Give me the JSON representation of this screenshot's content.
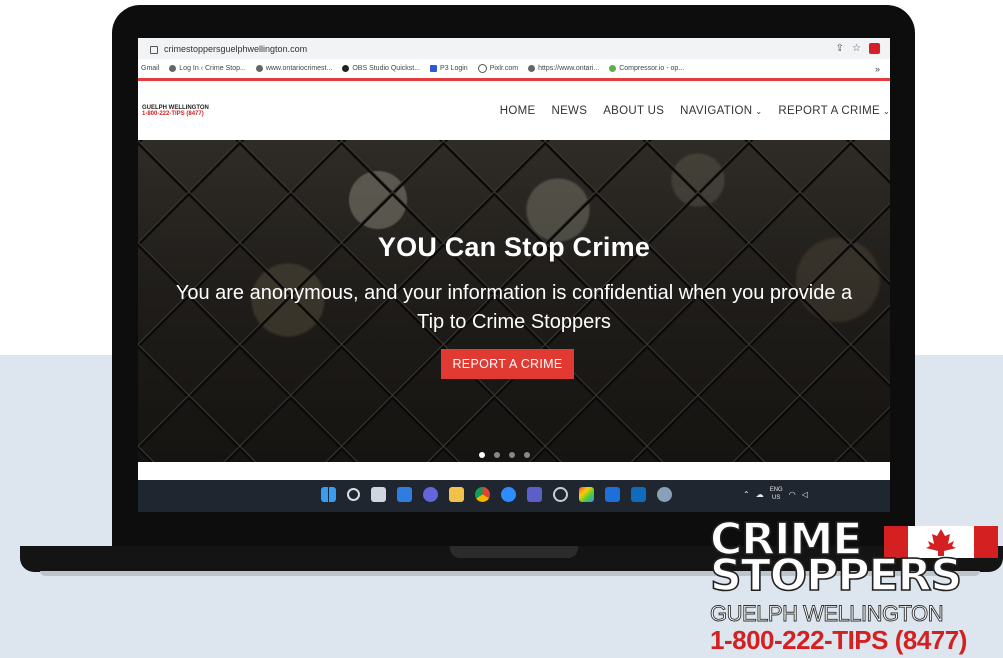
{
  "browser": {
    "url": "crimestoppersguelphwellington.com",
    "bookmarks": [
      "Gmail",
      "Log In ‹ Crime Stop...",
      "www.ontariocrimest...",
      "OBS Studio Quickst...",
      "P3 Login",
      "Pixlr.com",
      "https://www.ontari...",
      "Compressor.io - op..."
    ],
    "more": "»"
  },
  "site": {
    "logo_line1": "GUELPH WELLINGTON",
    "logo_line2": "1-800-222-TIPS (8477)",
    "nav": {
      "home": "HOME",
      "news": "NEWS",
      "about": "ABOUT US",
      "navigation": "NAVIGATION",
      "report": "REPORT A CRIME"
    }
  },
  "hero": {
    "title": "YOU Can Stop Crime",
    "subtitle": "You are anonymous, and your information is confidential when you provide a Tip to Crime Stoppers",
    "button": "REPORT A CRIME",
    "slides": 4,
    "active_slide": 1
  },
  "taskbar": {
    "lang1": "ENG",
    "lang2": "US"
  },
  "brand": {
    "line1": "CRIME",
    "line2": "STOPPERS",
    "line3": "GUELPH WELLINGTON",
    "line4": "1-800-222-TIPS (8477)"
  },
  "colors": {
    "accent_red": "#e03a32",
    "band_blue": "#dde6ee"
  }
}
